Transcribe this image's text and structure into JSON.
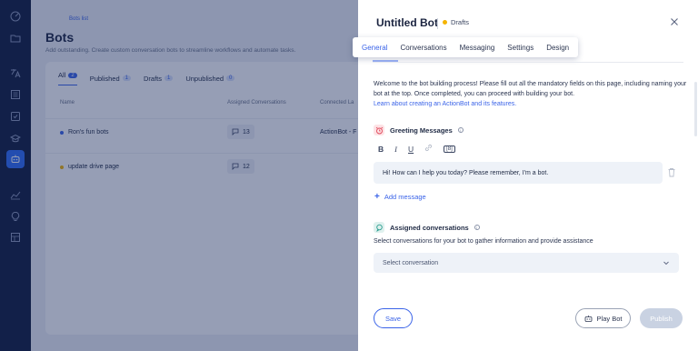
{
  "rail": {
    "icons": [
      "dashboard-icon",
      "folder-icon",
      "translate-icon",
      "list-icon",
      "inbox-check-icon",
      "graduation-icon",
      "bot-icon",
      "analytics-icon",
      "lightbulb-icon",
      "table-icon"
    ]
  },
  "background": {
    "breadcrumb": "Bots list",
    "title": "Bots",
    "subtitle": "Add outstanding. Create custom conversation bots to streamline workflows and automate tasks.",
    "tabs": [
      {
        "label": "All",
        "count": "2"
      },
      {
        "label": "Published",
        "count": "1"
      },
      {
        "label": "Drafts",
        "count": "1"
      },
      {
        "label": "Unpublished",
        "count": "0"
      }
    ],
    "columns": [
      "Name",
      "Assigned Conversations",
      "Connected La"
    ],
    "rows": [
      {
        "name": "Ron's fun bots",
        "conversations": "13",
        "connected": "ActionBot - F",
        "status_color": "#3a63e8"
      },
      {
        "name": "update drive page",
        "conversations": "12",
        "connected": "",
        "status_color": "#f5b400"
      }
    ]
  },
  "panel": {
    "title": "Untitled Bot",
    "status": "Drafts",
    "tabs": [
      "General",
      "Conversations",
      "Messaging",
      "Settings",
      "Design"
    ],
    "active_tab": "General",
    "intro": "Welcome to the bot building process! Please fill out all the mandatory fields on this page, including naming your bot at the top. Once completed, you can proceed with building your bot.",
    "intro_link": "Learn about creating an ActionBot and its features.",
    "greeting": {
      "heading": "Greeting Messages",
      "format_buttons": [
        "B",
        "I",
        "U",
        "link-icon",
        "[8]"
      ],
      "message": "Hi! How can I help you today? Please remember, I'm a bot.",
      "add_label": "Add message"
    },
    "assigned": {
      "heading": "Assigned conversations",
      "description": "Select conversations for your bot to gather information and provide assistance",
      "placeholder": "Select conversation"
    },
    "footer": {
      "save": "Save",
      "play": "Play Bot",
      "publish": "Publish"
    }
  },
  "colors": {
    "accent": "#3a63e8",
    "rail": "#0f1b3b",
    "draft": "#f5b400"
  }
}
